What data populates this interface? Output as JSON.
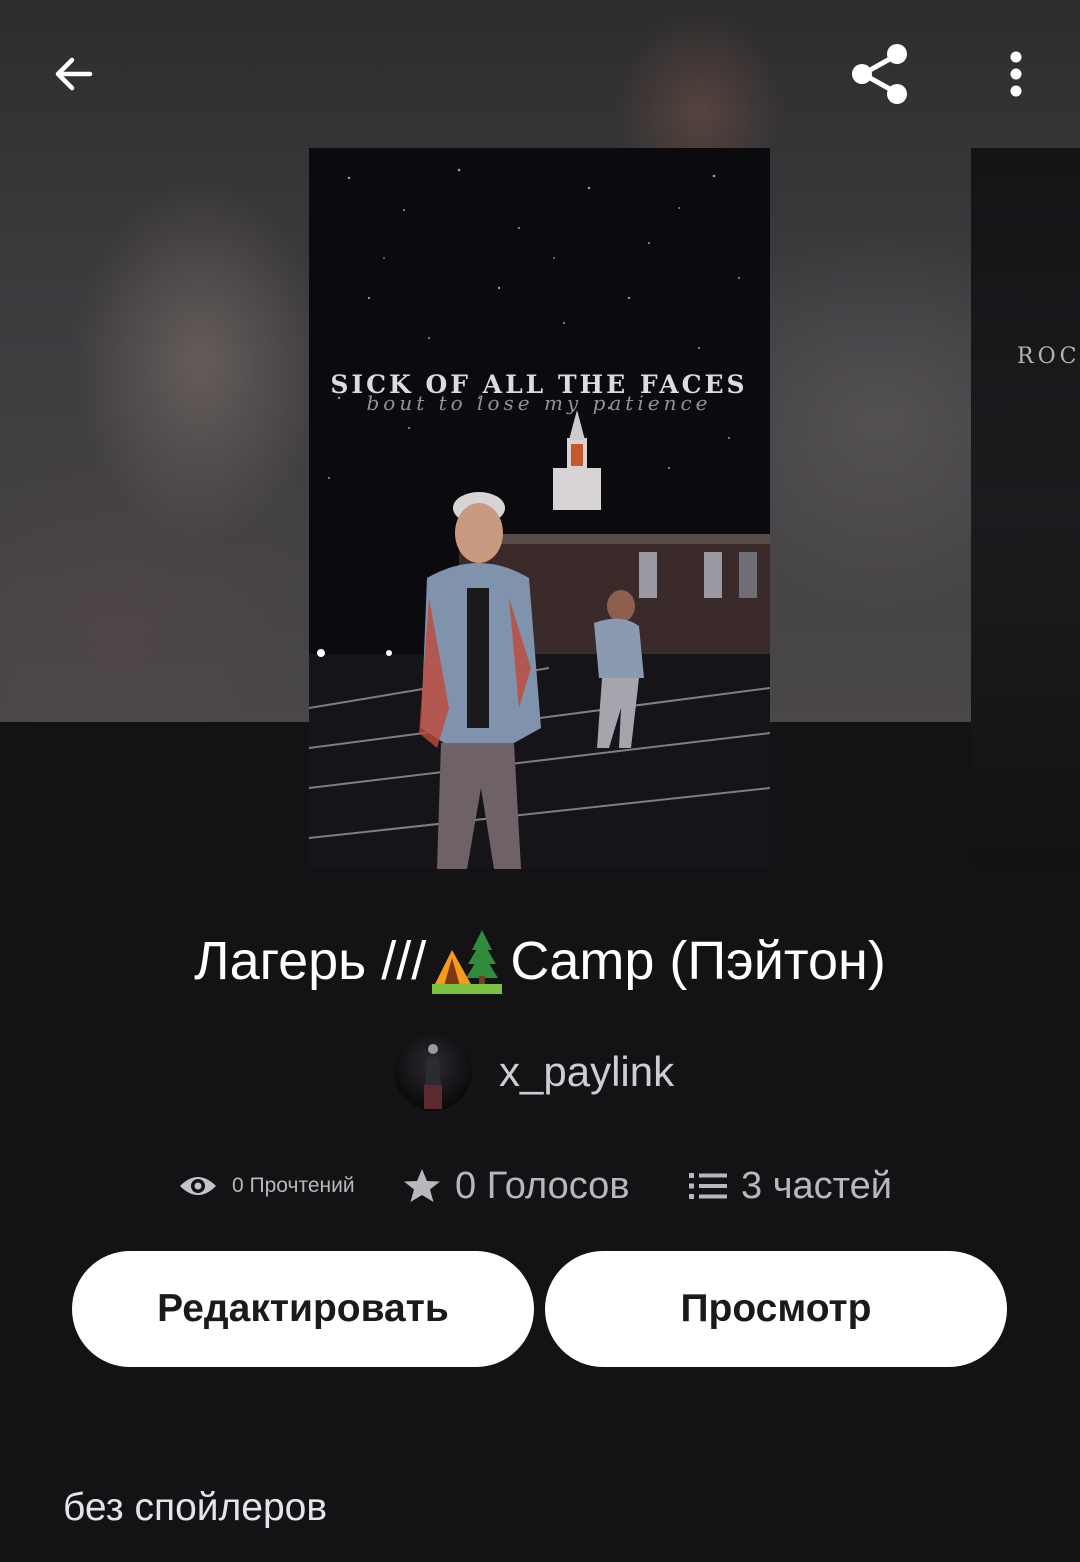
{
  "toolbar": {
    "back_icon": "arrow-left-icon",
    "share_icon": "share-icon",
    "more_icon": "more-vertical-icon"
  },
  "cover": {
    "headline": "SICK OF ALL THE FACES",
    "subline": "bout to lose my patience",
    "next_cover_text": "ROCK"
  },
  "story": {
    "title_prefix": "Лагерь ///",
    "title_icon": "camping-tent-emoji",
    "title_suffix": " Camp (Пэйтон)",
    "author": "x_paylink"
  },
  "stats": {
    "reads_icon": "eye-icon",
    "reads": "0 Прочтений",
    "votes_icon": "star-icon",
    "votes": "0 Голосов",
    "parts_icon": "list-icon",
    "parts": "3 частей"
  },
  "actions": {
    "edit_label": "Редактировать",
    "preview_label": "Просмотр"
  },
  "description": "без спойлеров",
  "colors": {
    "background": "#131214",
    "button_bg": "#ffffff",
    "button_text": "#1a191b",
    "secondary_text": "#b9b7bb"
  }
}
